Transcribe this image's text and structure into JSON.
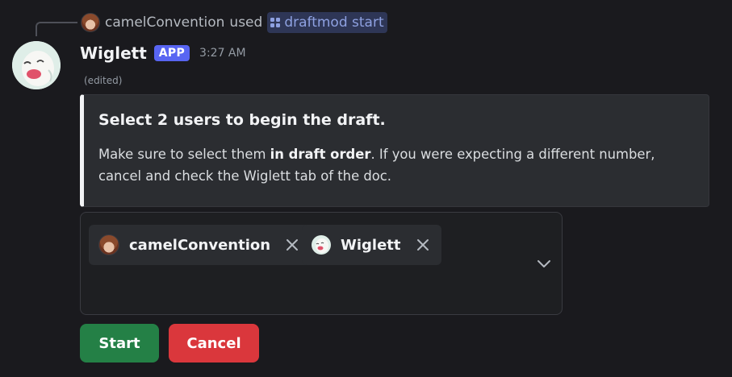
{
  "reply": {
    "user": "camelConvention",
    "used_text": "used",
    "command_icon": "slash-command-icon",
    "command": "draftmod start"
  },
  "message": {
    "author": "Wiglett",
    "badge": "APP",
    "timestamp": "3:27 AM",
    "edited": "(edited)"
  },
  "embed": {
    "title": "Select 2 users to begin the draft.",
    "desc_part1": "Make sure to select them ",
    "desc_bold": "in draft order",
    "desc_part2": ". If you were expecting a different number, cancel and check the Wiglett tab of the doc.",
    "accent_color": "#f2f3f5"
  },
  "user_select": {
    "selected": [
      {
        "label": "camelConvention",
        "avatar": "camel-avatar"
      },
      {
        "label": "Wiglett",
        "avatar": "wiglett-avatar"
      }
    ],
    "remove_icon": "close-icon",
    "dropdown_icon": "chevron-down-icon"
  },
  "buttons": {
    "start_label": "Start",
    "start_color": "#248046",
    "cancel_label": "Cancel",
    "cancel_color": "#da373c"
  }
}
